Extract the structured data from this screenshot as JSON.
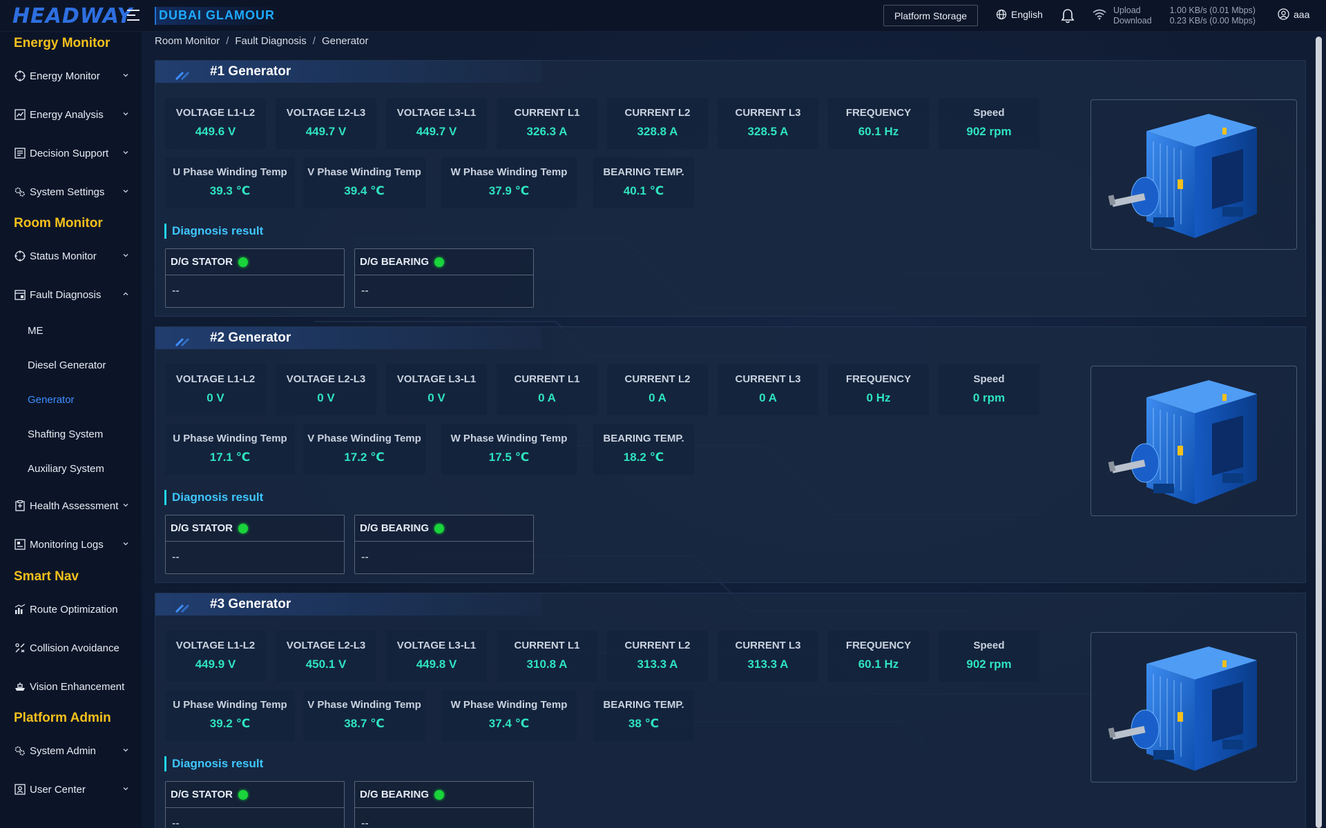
{
  "topbar": {
    "logo": "HEADWAY",
    "ship_name": "DUBAI GLAMOUR",
    "platform_storage": "Platform Storage",
    "language": "English",
    "net_upload_label": "Upload",
    "net_download_label": "Download",
    "net_upload_value": "1.00 KB/s (0.01 Mbps)",
    "net_download_value": "0.23 KB/s (0.00 Mbps)",
    "username": "aaa"
  },
  "sidebar": {
    "sections": [
      {
        "title": "Energy Monitor",
        "items": [
          "Energy Monitor",
          "Energy Analysis",
          "Decision Support",
          "System Settings"
        ]
      },
      {
        "title": "Room Monitor",
        "items": [
          "Status Monitor",
          "Fault Diagnosis"
        ]
      },
      {
        "title": "Smart Nav",
        "items": [
          "Route Optimization",
          "Collision Avoidance",
          "Vision Enhancement"
        ]
      },
      {
        "title": "Platform Admin",
        "items": [
          "System Admin",
          "User Center"
        ]
      }
    ],
    "fault_sub": [
      "ME",
      "Diesel Generator",
      "Generator",
      "Shafting System",
      "Auxiliary System"
    ],
    "room_extra": [
      "Health Assessment",
      "Monitoring Logs"
    ],
    "active_sub": "Generator"
  },
  "breadcrumb": [
    "Room Monitor",
    "Fault Diagnosis",
    "Generator"
  ],
  "metric_labels": {
    "row1": [
      "VOLTAGE L1-L2",
      "VOLTAGE L2-L3",
      "VOLTAGE L3-L1",
      "CURRENT L1",
      "CURRENT L2",
      "CURRENT L3",
      "FREQUENCY",
      "Speed"
    ],
    "row2": [
      "U Phase Winding Temp",
      "V Phase Winding Temp",
      "W Phase Winding Temp",
      "BEARING TEMP."
    ]
  },
  "diagnosis_title": "Diagnosis result",
  "diag_labels": [
    "D/G STATOR",
    "D/G BEARING"
  ],
  "status_color": "#19d43a",
  "generators": [
    {
      "title": "#1 Generator",
      "row1": [
        "449.6 V",
        "449.7 V",
        "449.7 V",
        "326.3 A",
        "328.8 A",
        "328.5 A",
        "60.1 Hz",
        "902 rpm"
      ],
      "row2": [
        "39.3 ℃",
        "39.4 ℃",
        "37.9 ℃",
        "40.1 ℃"
      ],
      "diag": [
        "--",
        "--"
      ]
    },
    {
      "title": "#2 Generator",
      "row1": [
        "0 V",
        "0 V",
        "0 V",
        "0 A",
        "0 A",
        "0 A",
        "0 Hz",
        "0 rpm"
      ],
      "row2": [
        "17.1 ℃",
        "17.2 ℃",
        "17.5 ℃",
        "18.2 ℃"
      ],
      "diag": [
        "--",
        "--"
      ]
    },
    {
      "title": "#3 Generator",
      "row1": [
        "449.9 V",
        "450.1 V",
        "449.8 V",
        "310.8 A",
        "313.3 A",
        "313.3 A",
        "60.1 Hz",
        "902 rpm"
      ],
      "row2": [
        "39.2 ℃",
        "38.7 ℃",
        "37.4 ℃",
        "38 ℃"
      ],
      "diag": [
        "--",
        "--"
      ]
    }
  ]
}
